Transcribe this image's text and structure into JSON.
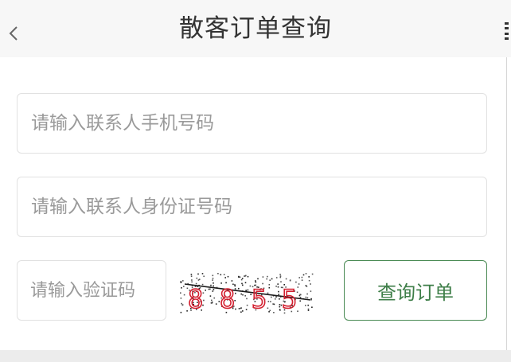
{
  "header": {
    "title": "散客订单查询",
    "back_icon": "chevron-left-icon"
  },
  "form": {
    "phone": {
      "placeholder": "请输入联系人手机号码",
      "value": ""
    },
    "id_number": {
      "placeholder": "请输入联系人身份证号码",
      "value": ""
    },
    "captcha": {
      "placeholder": "请输入验证码",
      "value": "",
      "image_text": [
        "8",
        "8",
        "5",
        "5"
      ],
      "image_color": "#d32030"
    },
    "submit_label": "查询订单"
  },
  "colors": {
    "accent": "#3e7e48",
    "header_bg": "#f7f7f7",
    "placeholder": "#9a9a9a"
  }
}
